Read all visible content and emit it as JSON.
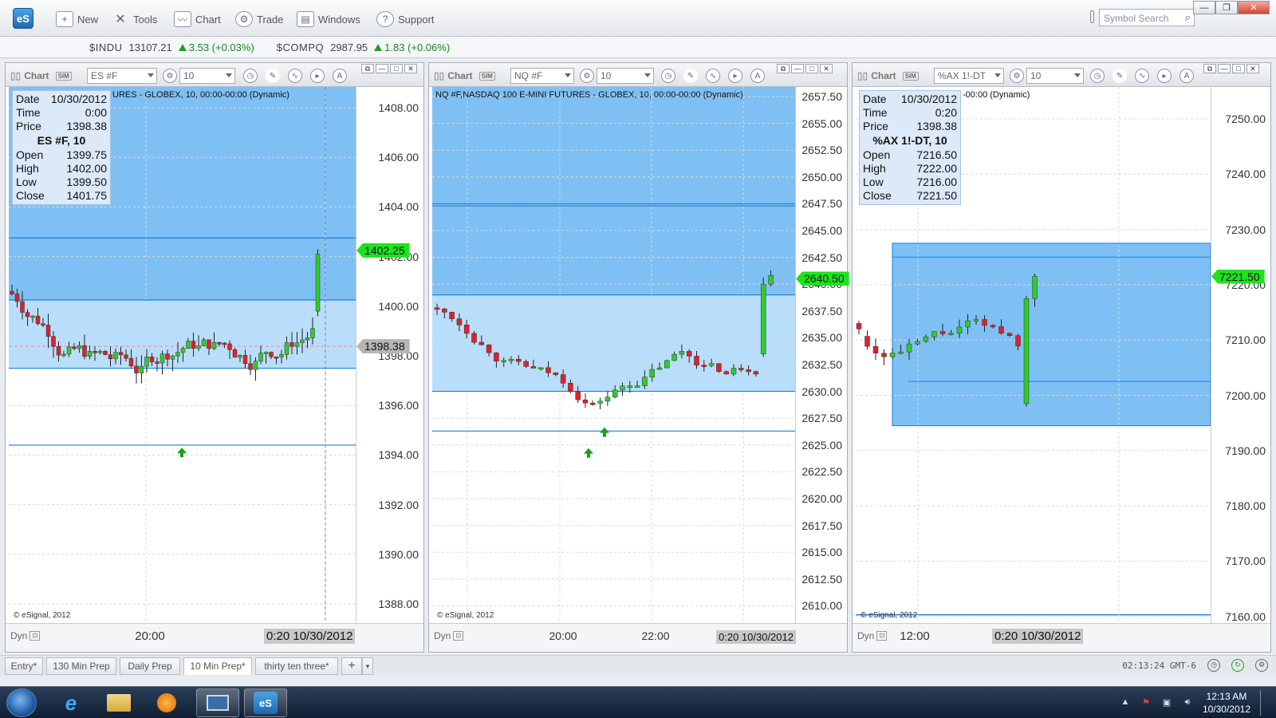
{
  "toolbar": {
    "logo": "eS",
    "buttons": [
      "New",
      "Tools",
      "Chart",
      "Trade",
      "Windows",
      "Support"
    ],
    "symbol_search_placeholder": "Symbol Search"
  },
  "ticker": [
    {
      "symbol": "$INDU",
      "value": "13107.21",
      "change": "3.53 (+0.03%)"
    },
    {
      "symbol": "$COMPQ",
      "value": "2987.95",
      "change": "1.83 (+0.06%)"
    }
  ],
  "charts": [
    {
      "title": "Chart",
      "symbol": "ES #F",
      "interval": "10",
      "caption": "URES - GLOBEX, 10, 00:00-00:00 (Dynamic)",
      "info": {
        "date": "10/30/2012",
        "time": "0:00",
        "price": "1398.38",
        "header": "ES #F, 10",
        "open": "1399.75",
        "high": "1402.00",
        "low": "1399.50",
        "close": "1401.75"
      },
      "y_labels": [
        "1408.00",
        "1406.00",
        "1404.00",
        "1402.00",
        "1400.00",
        "1398.00",
        "1396.00",
        "1394.00",
        "1392.00",
        "1390.00",
        "1388.00"
      ],
      "current_price": "1402.25",
      "cursor_price": "1398.38",
      "x_labels": [
        "20:00"
      ],
      "x_cursor": "0:20 10/30/2012",
      "copyright": "© eSignal, 2012",
      "dyn": "Dyn"
    },
    {
      "title": "Chart",
      "symbol": "NQ #F",
      "interval": "10",
      "caption": "NQ #F,NASDAQ 100 E-MINI FUTURES - GLOBEX, 10, 00:00-00:00 (Dynamic)",
      "y_labels": [
        "2657.50",
        "2655.00",
        "2652.50",
        "2650.00",
        "2647.50",
        "2645.00",
        "2642.50",
        "2640.00",
        "2637.50",
        "2635.00",
        "2632.50",
        "2630.00",
        "2627.50",
        "2625.00",
        "2622.50",
        "2620.00",
        "2617.50",
        "2615.00",
        "2612.50",
        "2610.00"
      ],
      "current_price": "2640.50",
      "x_labels": [
        "20:00",
        "22:00"
      ],
      "x_cursor": "0:20 10/30/2012",
      "copyright": "© eSignal, 2012",
      "dyn": "Dyn"
    },
    {
      "title": "Chart",
      "symbol": "%AX 1!-DT",
      "interval": "10",
      "caption": "-00:00 (Dynamic)",
      "info": {
        "date": "10/30/2012",
        "time": "0:20",
        "price": "1398.38",
        "header": "%AX 1!-DT, 10",
        "open": "7216.50",
        "high": "7222.00",
        "low": "7216.00",
        "close": "7221.50"
      },
      "y_labels": [
        "7250.00",
        "7240.00",
        "7230.00",
        "7220.00",
        "7210.00",
        "7200.00",
        "7190.00",
        "7180.00",
        "7170.00",
        "7160.00"
      ],
      "current_price": "7221.50",
      "x_labels": [
        "12:00"
      ],
      "x_cursor": "0:20 10/30/2012",
      "copyright": "© eSignal, 2012",
      "dyn": "Dyn"
    }
  ],
  "tabs": [
    "Entry*",
    "130 Min Prep",
    "Daily Prep",
    "10 Min Prep*",
    "thirty ten three*"
  ],
  "active_tab": "10 Min Prep*",
  "status_clock": "02:13:24 GMT-6",
  "taskbar": {
    "time": "12:13 AM",
    "date": "10/30/2012"
  },
  "colors": {
    "bull": "#2ecc2e",
    "bear": "#e0202a",
    "zone_dark": "#7fc0f4",
    "zone_light": "#b8defb",
    "line": "#1a7fd8",
    "arrow": "#18a018"
  }
}
